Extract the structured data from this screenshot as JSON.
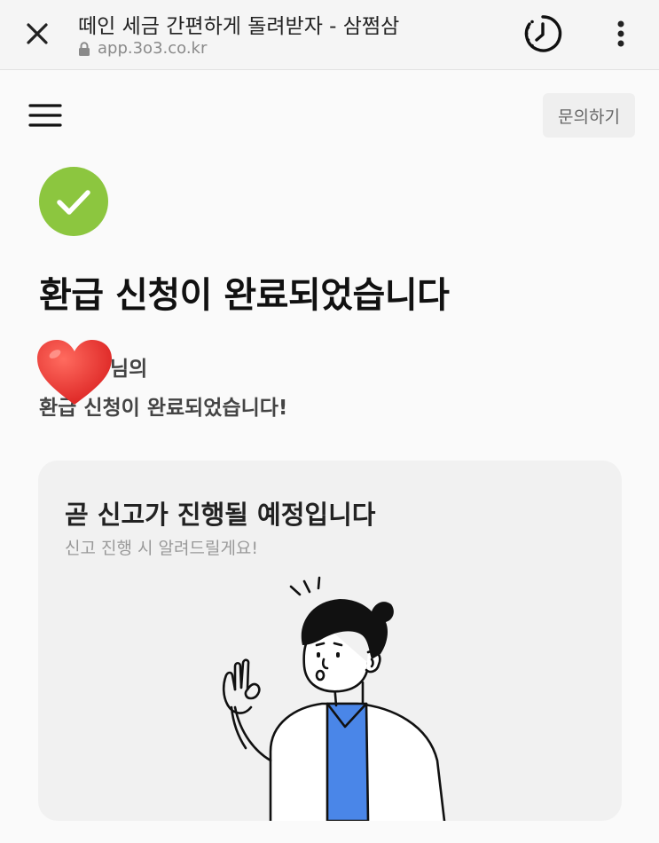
{
  "browser": {
    "tab_title": "떼인 세금 간편하게 돌려받자 - 삼쩜삼",
    "url": "app.3o3.co.kr",
    "icons": [
      "close-icon",
      "lock-icon",
      "history-icon",
      "more-vertical-icon"
    ]
  },
  "header": {
    "menu_icon": "hamburger-icon",
    "inquiry_label": "문의하기"
  },
  "status": {
    "icon": "check-circle-icon",
    "accent_color": "#8cc63f",
    "headline": "환급 신청이 완료되었습니다",
    "name_suffix": "님의",
    "message": "환급 신청이 완료되었습니다!"
  },
  "card": {
    "title": "곧 신고가 진행될 예정입니다",
    "subtitle": "신고 진행 시 알려드릴게요!",
    "illustration": "person-ok-gesture-illustration",
    "shirt_color": "#4a86e8"
  },
  "overlay": {
    "sticker": "heart-emoji",
    "color": "#e53935"
  }
}
